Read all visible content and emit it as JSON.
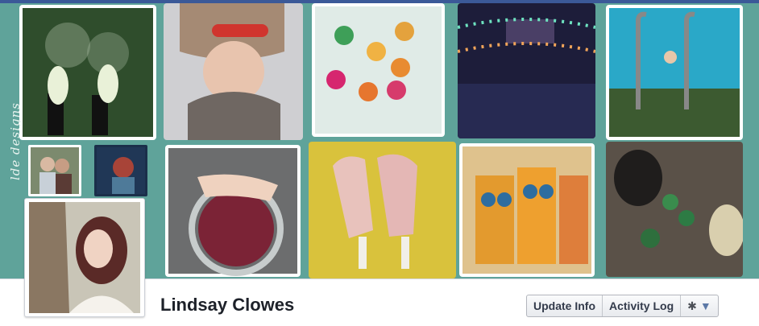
{
  "profile": {
    "name": "Lindsay Clowes"
  },
  "cover": {
    "watermark_text": "lde designs",
    "photos": [
      {
        "name": "handprints-feet-photo"
      },
      {
        "name": "knit-hat-selfie-photo"
      },
      {
        "name": "painted-rings-photo"
      },
      {
        "name": "string-lights-photo"
      },
      {
        "name": "pool-ladder-photo"
      },
      {
        "name": "couple-photo"
      },
      {
        "name": "red-hair-photo"
      },
      {
        "name": "crochet-yarn-photo"
      },
      {
        "name": "popsicles-photo"
      },
      {
        "name": "owl-cups-photo"
      },
      {
        "name": "dog-toys-photo"
      }
    ]
  },
  "actions": {
    "update_info": "Update Info",
    "activity_log": "Activity Log",
    "settings_icon": "gear-icon",
    "dropdown_icon": "chevron-down-icon"
  }
}
